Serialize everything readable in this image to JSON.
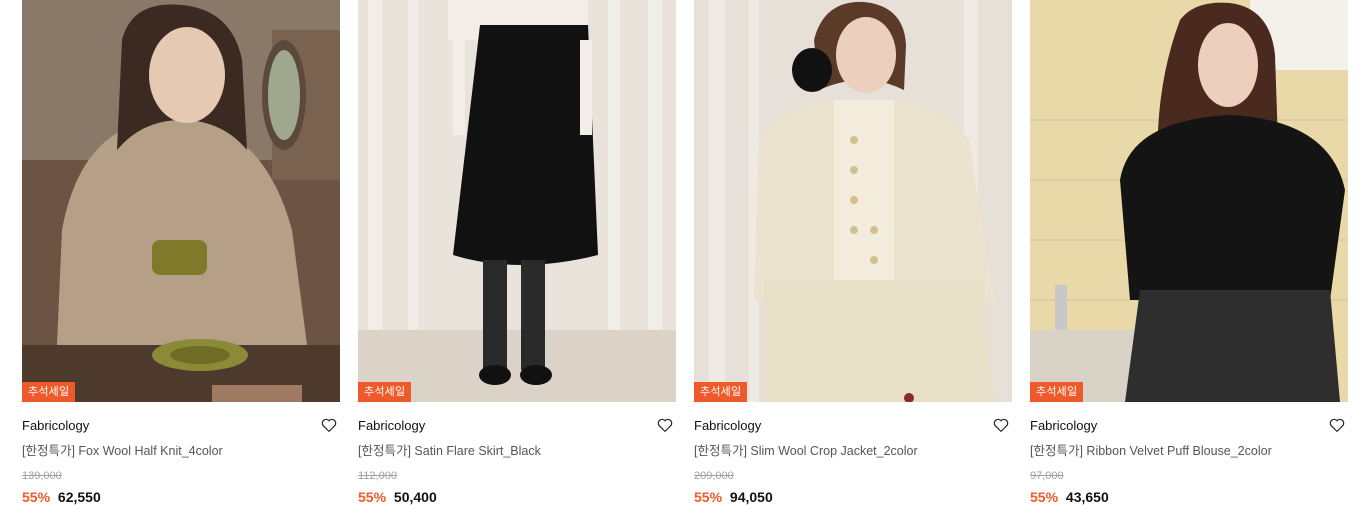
{
  "products": [
    {
      "badge": "추석세일",
      "brand": "Fabricology",
      "name": "[한정특가] Fox Wool Half Knit_4color",
      "original_price": "139,000",
      "discount": "55%",
      "price": "62,550"
    },
    {
      "badge": "추석세일",
      "brand": "Fabricology",
      "name": "[한정특가] Satin Flare Skirt_Black",
      "original_price": "112,000",
      "discount": "55%",
      "price": "50,400"
    },
    {
      "badge": "추석세일",
      "brand": "Fabricology",
      "name": "[한정특가] Slim Wool Crop Jacket_2color",
      "original_price": "209,000",
      "discount": "55%",
      "price": "94,050"
    },
    {
      "badge": "추석세일",
      "brand": "Fabricology",
      "name": "[한정특가] Ribbon Velvet Puff Blouse_2color",
      "original_price": "97,000",
      "discount": "55%",
      "price": "43,650"
    }
  ],
  "icons": {
    "wishlist": "heart-outline-icon"
  },
  "colors": {
    "accent": "#ef5a2a",
    "badge_text": "#ffffff"
  }
}
